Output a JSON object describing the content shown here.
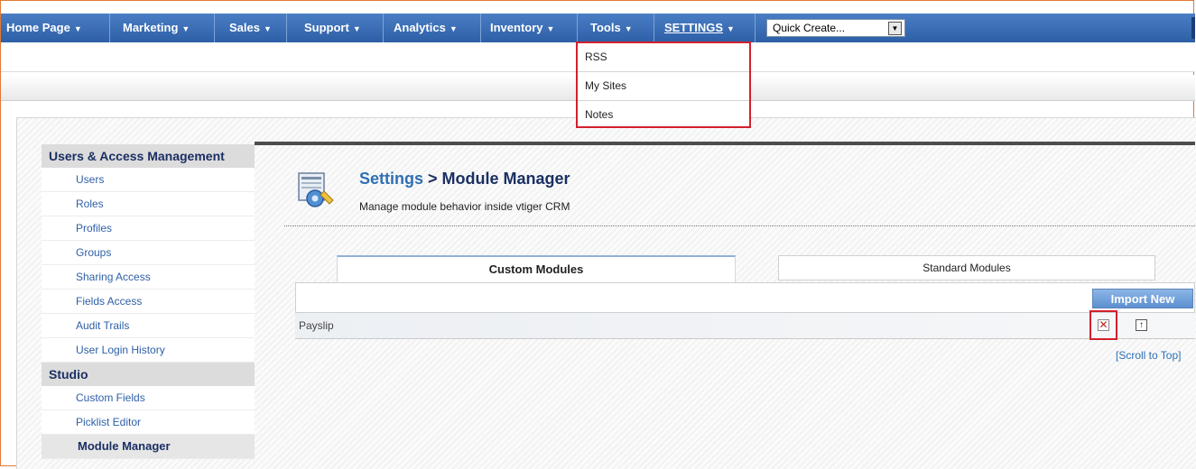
{
  "topnav": {
    "items": [
      {
        "label": "Home Page"
      },
      {
        "label": "Marketing"
      },
      {
        "label": "Sales"
      },
      {
        "label": "Support"
      },
      {
        "label": "Analytics"
      },
      {
        "label": "Inventory"
      },
      {
        "label": "Tools"
      },
      {
        "label": "SETTINGS"
      }
    ],
    "quick_create": "Quick Create..."
  },
  "settings_menu": {
    "items": [
      "RSS",
      "My Sites",
      "Notes"
    ]
  },
  "sidebar": {
    "sections": [
      {
        "heading": "Users & Access Management",
        "items": [
          "Users",
          "Roles",
          "Profiles",
          "Groups",
          "Sharing Access",
          "Fields Access",
          "Audit Trails",
          "User Login History"
        ]
      },
      {
        "heading": "Studio",
        "items": [
          "Custom Fields",
          "Picklist Editor",
          "Module Manager"
        ]
      }
    ],
    "active_item": "Module Manager"
  },
  "header": {
    "crumb": "Settings",
    "separator": " > ",
    "title": "Module Manager",
    "subtitle": "Manage module behavior inside vtiger CRM"
  },
  "tabs": {
    "custom": "Custom Modules",
    "standard": "Standard Modules"
  },
  "import_button": "Import New",
  "modules": [
    {
      "name": "Payslip"
    }
  ],
  "scroll_to_top": "[Scroll to Top]",
  "colors": {
    "nav_blue": "#2d5fa6",
    "highlight_red": "#d2202c",
    "link_blue": "#2e6fb5",
    "heading_navy": "#1b2f63"
  }
}
